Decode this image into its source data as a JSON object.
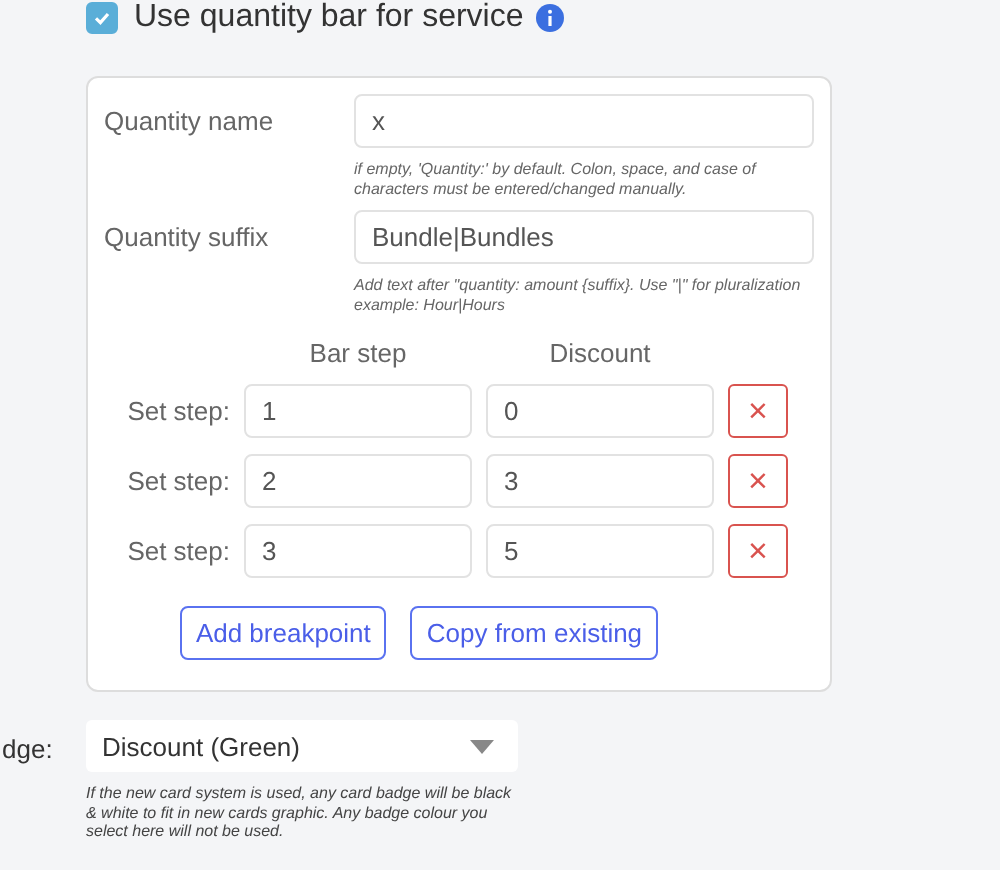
{
  "use_quantity_bar": {
    "label": "Use quantity bar for service",
    "checked": true
  },
  "quantity_name": {
    "label": "Quantity name",
    "value": "x",
    "help": "if empty, 'Quantity:' by default. Colon, space, and case of characters must be entered/changed manually."
  },
  "quantity_suffix": {
    "label": "Quantity suffix",
    "value": "Bundle|Bundles",
    "help": "Add text after \"quantity: amount {suffix}. Use \"|\" for pluralization example: Hour|Hours"
  },
  "steps_table": {
    "columns": [
      "Bar step",
      "Discount"
    ],
    "rows": [
      {
        "label": "Set step:",
        "bar_step": "1",
        "discount": "0",
        "delete": "×"
      },
      {
        "label": "Set step:",
        "bar_step": "2",
        "discount": "3",
        "delete": "×"
      },
      {
        "label": "Set step:",
        "bar_step": "3",
        "discount": "5",
        "delete": "×"
      }
    ]
  },
  "buttons": [
    "Add breakpoint",
    "Copy from existing"
  ],
  "badge": {
    "label": "dge:",
    "value": "Discount (Green)",
    "help": "If the new card system is used, any card badge will be black & white to fit in new cards graphic. Any badge colour you select here will not be used."
  }
}
